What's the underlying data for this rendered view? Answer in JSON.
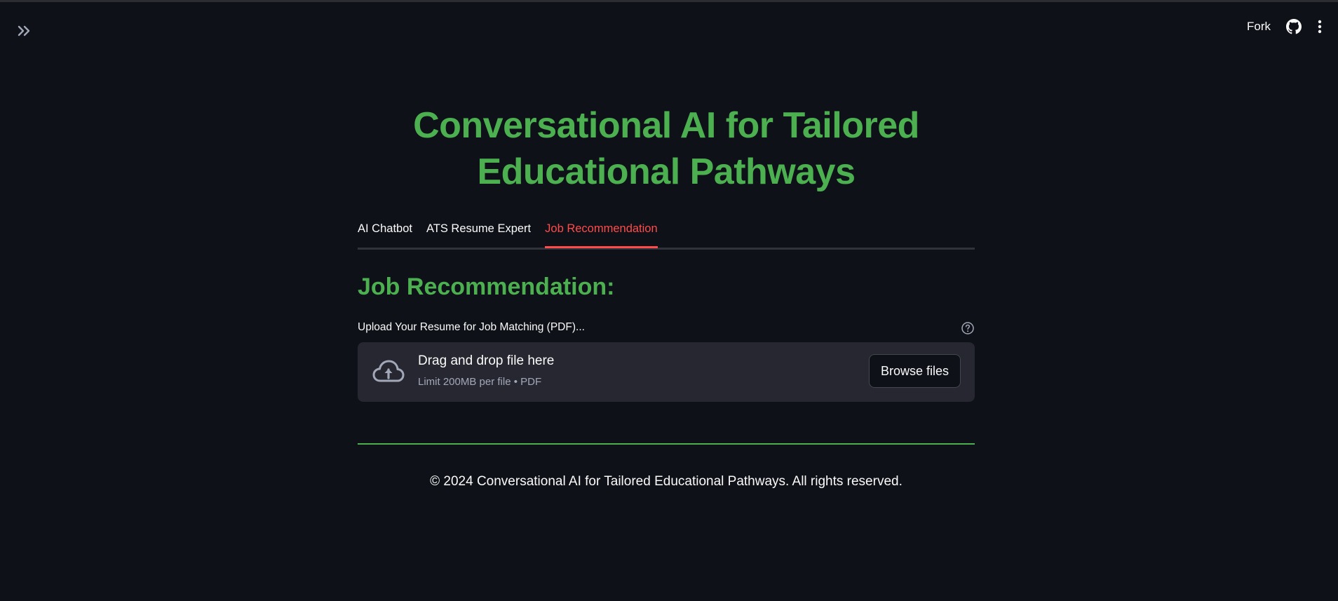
{
  "header": {
    "fork_label": "Fork",
    "icons": [
      "double-chevron-right-icon",
      "github-icon",
      "kebab-menu-icon"
    ]
  },
  "page": {
    "title": "Conversational AI for Tailored Educational Pathways"
  },
  "tabs": [
    {
      "label": "AI Chatbot",
      "active": false
    },
    {
      "label": "ATS Resume Expert",
      "active": false
    },
    {
      "label": "Job Recommendation",
      "active": true
    }
  ],
  "section": {
    "heading": "Job Recommendation:"
  },
  "uploader": {
    "label": "Upload Your Resume for Job Matching (PDF)...",
    "drop_title": "Drag and drop file here",
    "drop_subtitle": "Limit 200MB per file • PDF",
    "browse_label": "Browse files"
  },
  "footer": {
    "text": "© 2024 Conversational AI for Tailored Educational Pathways. All rights reserved."
  },
  "colors": {
    "background": "#0e1117",
    "title_green": "#4caf50",
    "active_tab": "#ff4b4b",
    "dropzone_bg": "#262730"
  }
}
